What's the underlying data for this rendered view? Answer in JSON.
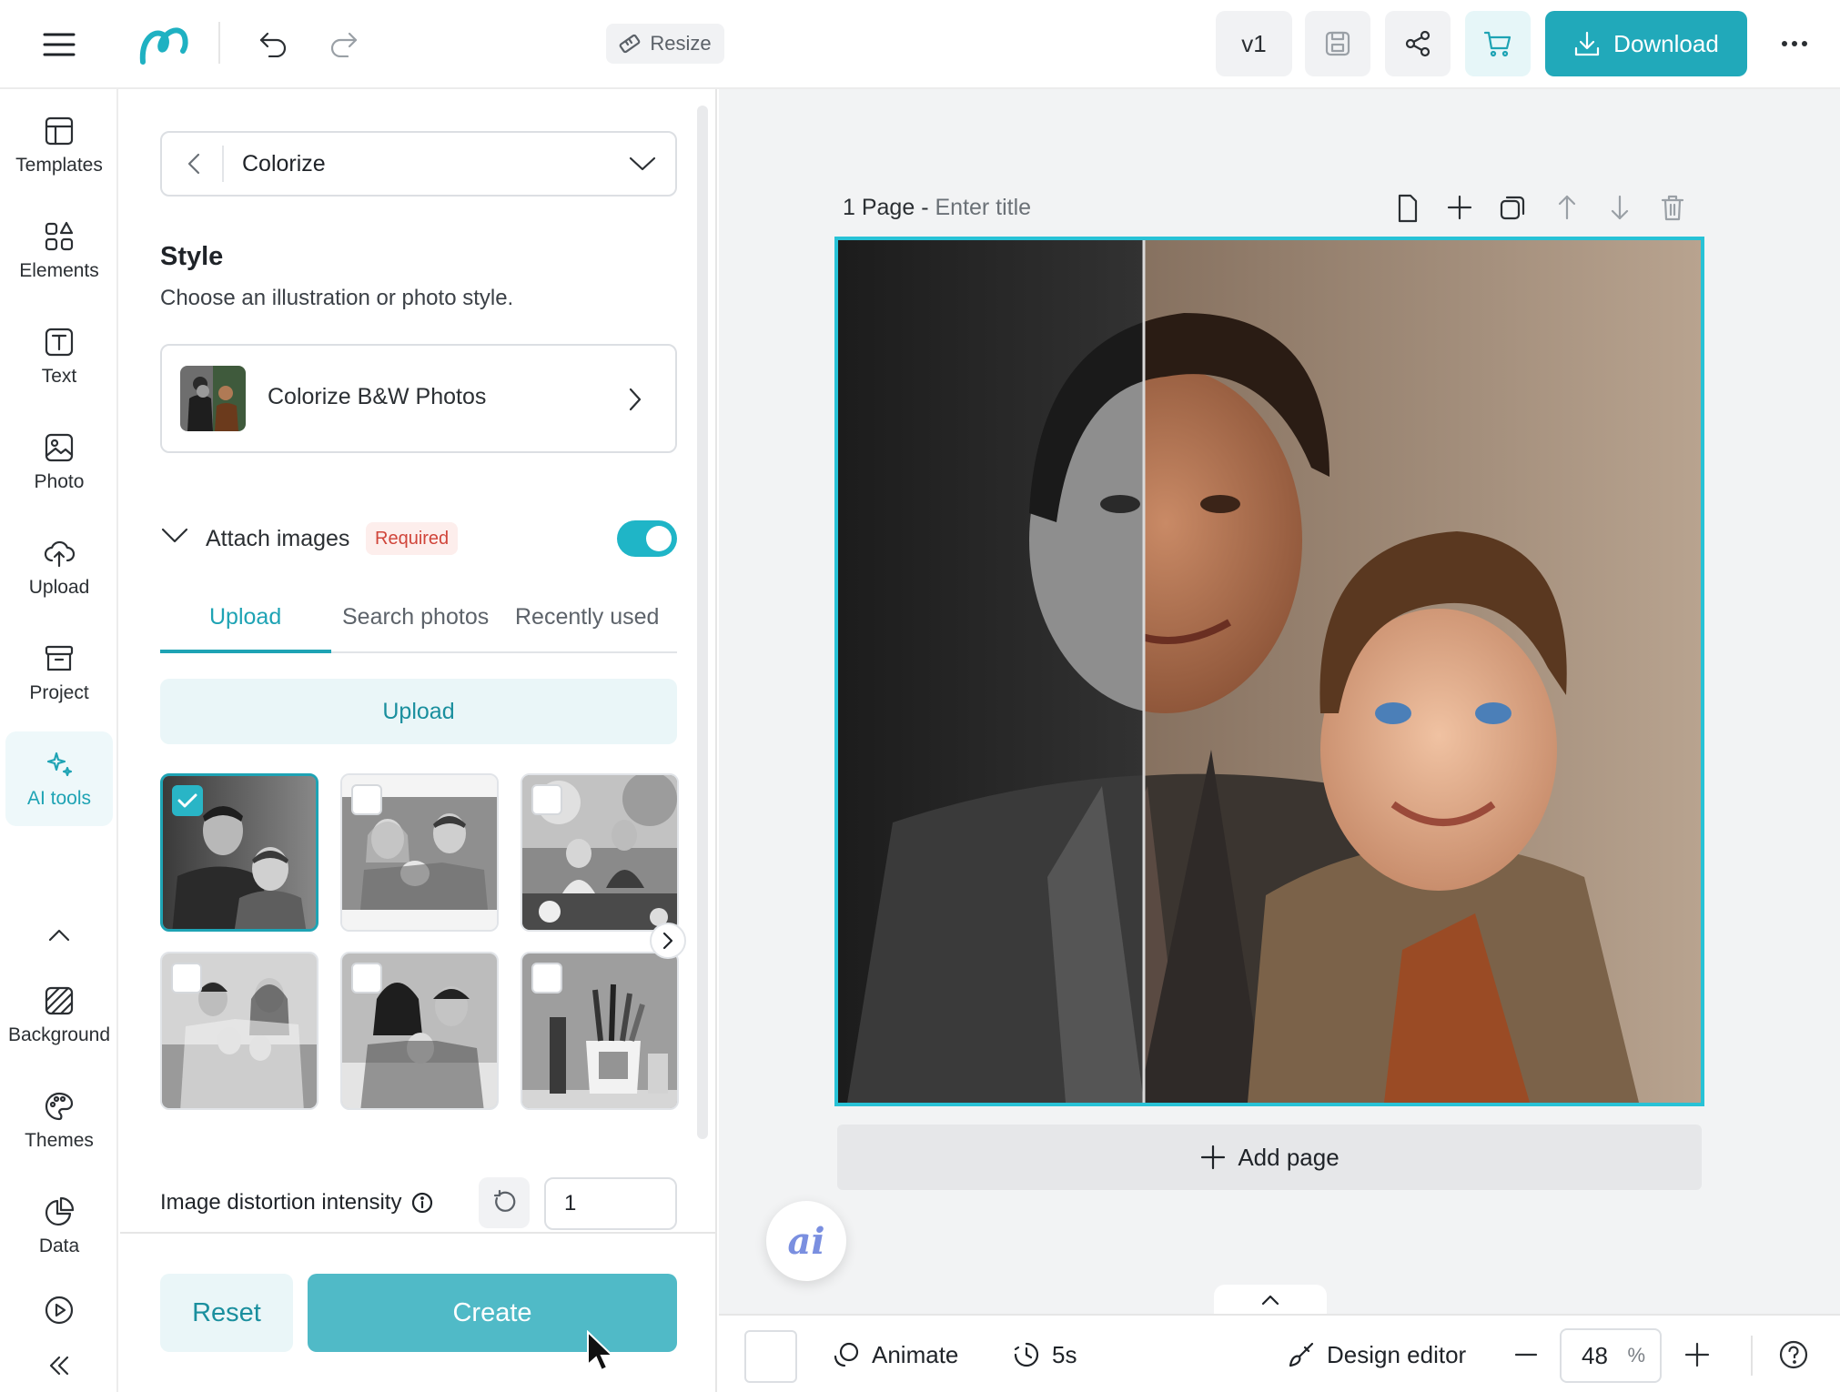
{
  "topbar": {
    "resize_label": "Resize",
    "version_label": "v1",
    "download_label": "Download"
  },
  "rail": {
    "items": [
      {
        "label": "Templates"
      },
      {
        "label": "Elements"
      },
      {
        "label": "Text"
      },
      {
        "label": "Photo"
      },
      {
        "label": "Upload"
      },
      {
        "label": "Project"
      },
      {
        "label": "AI tools"
      },
      {
        "label": "Background"
      },
      {
        "label": "Themes"
      },
      {
        "label": "Data"
      }
    ]
  },
  "panel": {
    "mode_value": "Colorize",
    "style_heading": "Style",
    "style_sub": "Choose an illustration or photo style.",
    "style_card_label": "Colorize B&W Photos",
    "attach_label": "Attach images",
    "required_badge": "Required",
    "attach_toggle_on": true,
    "tabs": [
      {
        "label": "Upload"
      },
      {
        "label": "Search photos"
      },
      {
        "label": "Recently used"
      }
    ],
    "upload_button": "Upload",
    "distortion_label": "Image distortion intensity",
    "distortion_value": "1",
    "reset_label": "Reset",
    "create_label": "Create"
  },
  "canvas": {
    "page_label": "1 Page",
    "title_placeholder": "Enter title",
    "add_page_label": "Add page",
    "ai_label": "ai"
  },
  "bottombar": {
    "animate_label": "Animate",
    "duration_label": "5s",
    "design_editor_label": "Design editor",
    "zoom_value": "48",
    "zoom_unit": "%"
  },
  "colors": {
    "accent": "#21a9ba",
    "accent_light": "#eaf6f8",
    "selection_border": "#28c2d6",
    "required_text": "#d0453a",
    "required_bg": "#fdeeec"
  }
}
